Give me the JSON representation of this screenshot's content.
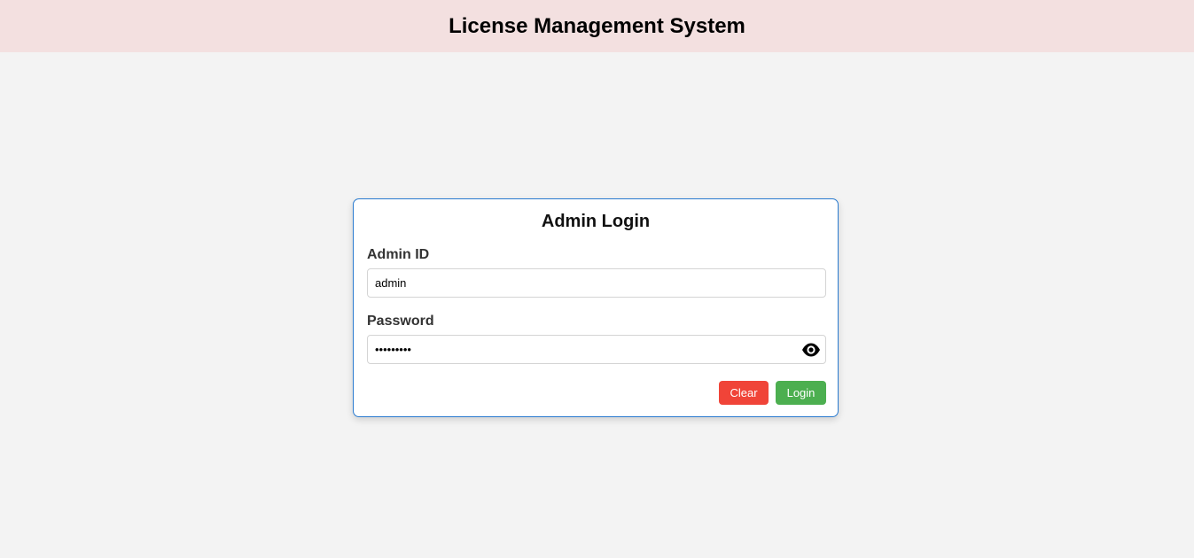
{
  "header": {
    "title": "License Management System"
  },
  "login": {
    "title": "Admin Login",
    "admin_id_label": "Admin ID",
    "admin_id_value": "admin",
    "password_label": "Password",
    "password_value": "•••••••••",
    "clear_label": "Clear",
    "login_label": "Login",
    "toggle_icon": "eye-icon"
  },
  "colors": {
    "header_bg": "#f3e0e0",
    "page_bg": "#f3f3f3",
    "card_border": "#2a7bd0",
    "clear_button": "#f04438",
    "login_button": "#4caf50"
  }
}
